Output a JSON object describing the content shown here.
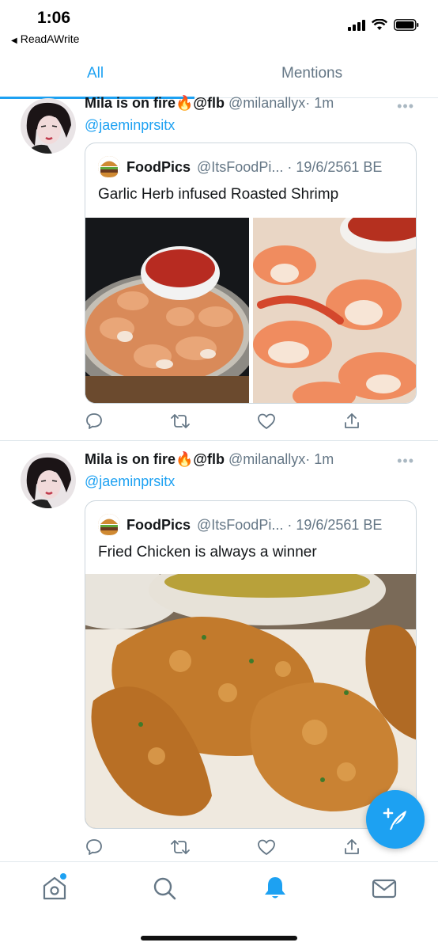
{
  "status_bar": {
    "time": "1:06",
    "back_app": "ReadAWrite"
  },
  "tabs": [
    {
      "label": "All",
      "active": true
    },
    {
      "label": "Mentions",
      "active": false
    }
  ],
  "tweets": [
    {
      "display_name": "Mila is on fire🔥@flb",
      "handle": "@milanallyx",
      "time": "· 1m",
      "reply_to": "@jaeminprsitx",
      "quote": {
        "name": "FoodPics",
        "meta": "@ItsFoodPi... · 19/6/2561 BE",
        "text": "Garlic Herb infused Roasted Shrimp"
      }
    },
    {
      "display_name": "Mila is on fire🔥@flb",
      "handle": "@milanallyx",
      "time": "· 1m",
      "reply_to": "@jaeminprsitx",
      "quote": {
        "name": "FoodPics",
        "meta": "@ItsFoodPi... · 19/6/2561 BE",
        "text": "Fried Chicken is always a winner"
      }
    }
  ],
  "icons": {
    "reply": "reply-icon",
    "retweet": "retweet-icon",
    "like": "heart-icon",
    "share": "share-icon",
    "more": "more-icon",
    "compose": "compose-icon",
    "nav": [
      "home-icon",
      "search-icon",
      "notifications-icon",
      "messages-icon"
    ]
  },
  "colors": {
    "accent": "#1da1f2",
    "secondary_text": "#657786",
    "border": "#e1e8ed"
  }
}
